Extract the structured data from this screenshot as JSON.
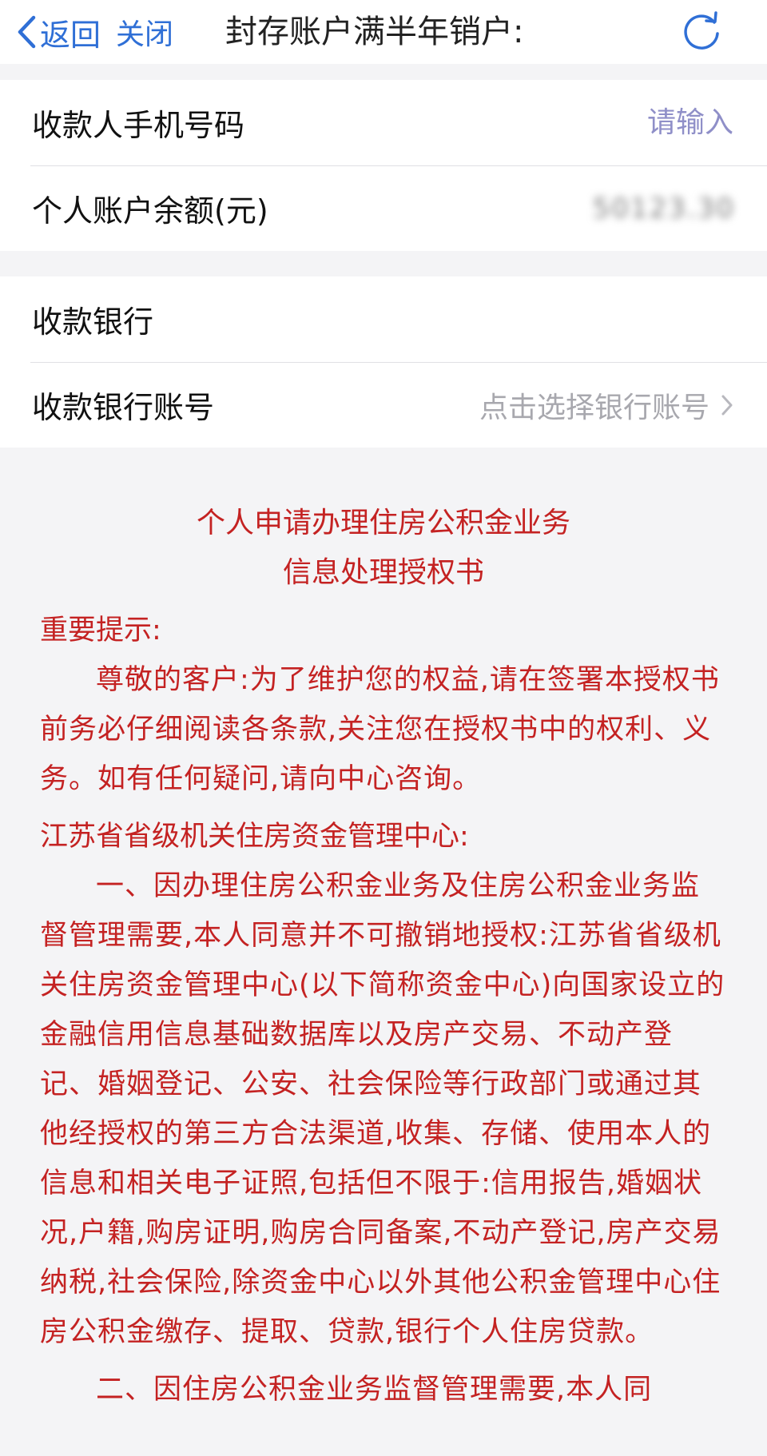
{
  "nav": {
    "back_label": "返回",
    "close_label": "关闭",
    "title": "封存账户满半年销户:"
  },
  "form_group_1": {
    "rows": [
      {
        "label": "收款人手机号码",
        "placeholder": "请输入"
      },
      {
        "label": "个人账户余额(元)",
        "value": "50123.30"
      }
    ]
  },
  "form_group_2": {
    "rows": [
      {
        "label": "收款银行",
        "value": ""
      },
      {
        "label": "收款银行账号",
        "value": "点击选择银行账号"
      }
    ]
  },
  "document": {
    "title_line1": "个人申请办理住房公积金业务",
    "title_line2": "信息处理授权书",
    "heading": "重要提示:",
    "notice": "尊敬的客户:为了维护您的权益,请在签署本授权书前务必仔细阅读各条款,关注您在授权书中的权利、义务。如有任何疑问,请向中心咨询。",
    "addressee": "江苏省省级机关住房资金管理中心:",
    "clause1": "一、因办理住房公积金业务及住房公积金业务监督管理需要,本人同意并不可撤销地授权:江苏省省级机关住房资金管理中心(以下简称资金中心)向国家设立的金融信用信息基础数据库以及房产交易、不动产登记、婚姻登记、公安、社会保险等行政部门或通过其他经授权的第三方合法渠道,收集、存储、使用本人的信息和相关电子证照,包括但不限于:信用报告,婚姻状况,户籍,购房证明,购房合同备案,不动产登记,房产交易纳税,社会保险,除资金中心以外其他公积金管理中心住房公积金缴存、提取、贷款,银行个人住房贷款。",
    "clause2": "二、因住房公积金业务监督管理需要,本人同"
  },
  "colors": {
    "accent": "#2f6fd6",
    "doc_text": "#c42222",
    "placeholder": "#8f8fc8",
    "background": "#f4f4f6"
  },
  "icons": {
    "back": "chevron-left-icon",
    "refresh": "refresh-icon",
    "row_arrow": "chevron-right-icon"
  }
}
